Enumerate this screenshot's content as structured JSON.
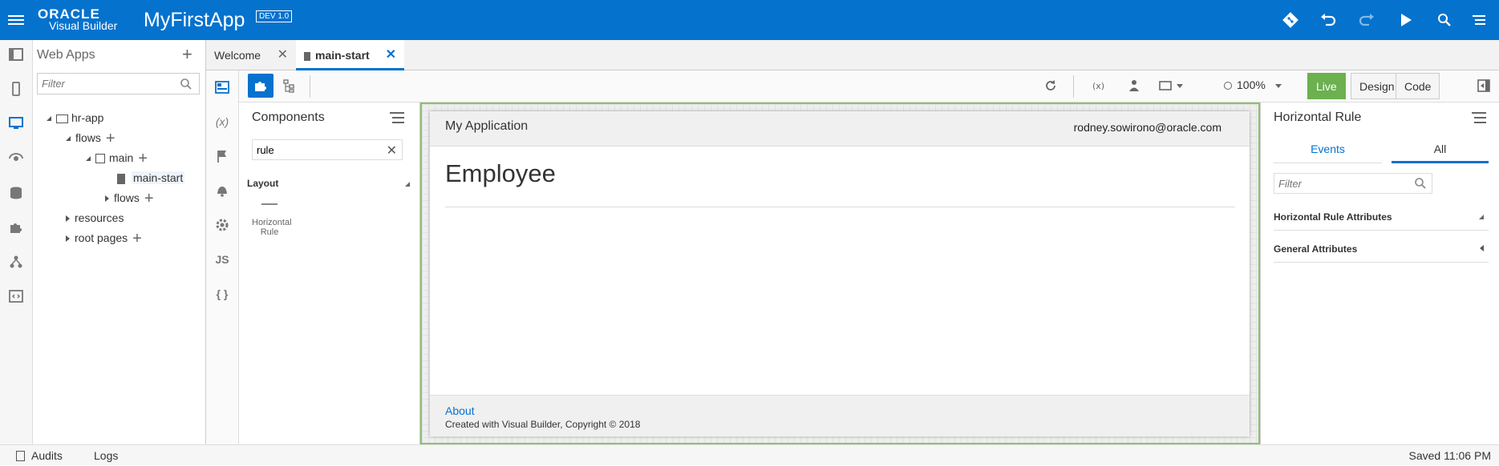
{
  "header": {
    "brand_top": "ORACLE",
    "brand_bottom": "Visual Builder",
    "app_title": "MyFirstApp",
    "env_badge": "DEV 1.0"
  },
  "webapps": {
    "title": "Web Apps",
    "filter_placeholder": "Filter",
    "tree": {
      "hr_app": "hr-app",
      "flows": "flows",
      "main": "main",
      "main_start": "main-start",
      "sub_flows": "flows",
      "resources": "resources",
      "root_pages": "root pages"
    }
  },
  "tabs": [
    {
      "label": "Welcome"
    },
    {
      "label": "main-start"
    }
  ],
  "toolbar": {
    "zoom": "100%",
    "modes": [
      "Live",
      "Design",
      "Code"
    ]
  },
  "components": {
    "title": "Components",
    "filter_value": "rule",
    "category": "Layout",
    "item_label": "Horizontal Rule"
  },
  "canvas": {
    "app_name": "My Application",
    "user_email": "rodney.sowirono@oracle.com",
    "heading": "Employee",
    "about_link": "About",
    "copyright": "Created with Visual Builder, Copyright © 2018"
  },
  "properties": {
    "title": "Horizontal Rule",
    "tabs": [
      "Events",
      "All"
    ],
    "filter_placeholder": "Filter",
    "sections": [
      "Horizontal Rule Attributes",
      "General Attributes"
    ]
  },
  "statusbar": {
    "audits": "Audits",
    "logs": "Logs",
    "saved": "Saved 11:06 PM"
  },
  "colors": {
    "brand_blue": "#0572ce",
    "live_green": "#6cb04f"
  }
}
